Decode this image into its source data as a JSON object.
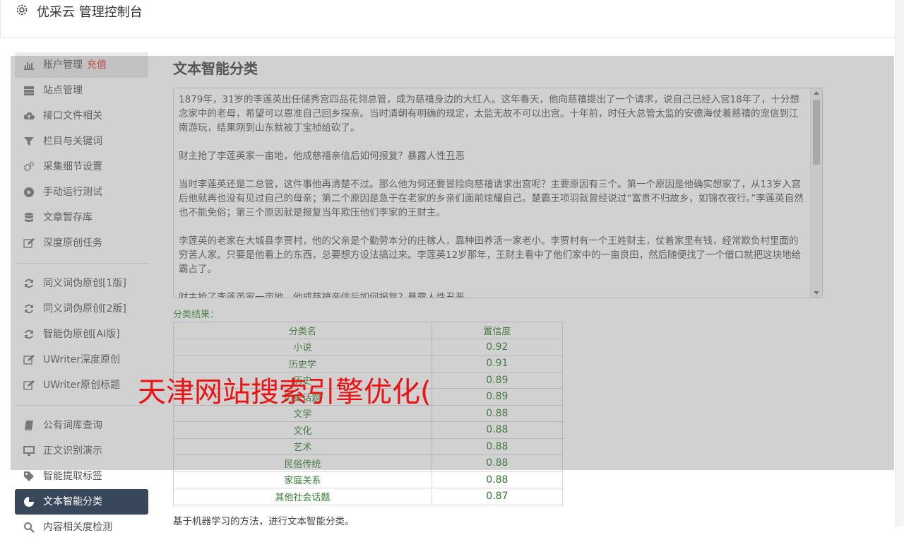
{
  "header": {
    "title": "优采云 管理控制台",
    "icon": "gear-icon"
  },
  "sidebar": {
    "groups": [
      [
        {
          "label": "账户管理",
          "badge": "充值",
          "icon": "bar-chart-icon"
        },
        {
          "label": "站点管理",
          "icon": "server-icon"
        },
        {
          "label": "接口文件相关",
          "icon": "cloud-upload-icon"
        },
        {
          "label": "栏目与关键词",
          "icon": "filter-icon"
        },
        {
          "label": "采集细节设置",
          "icon": "gears-icon"
        },
        {
          "label": "手动运行测试",
          "icon": "play-circle-icon"
        },
        {
          "label": "文章暂存库",
          "icon": "database-icon"
        },
        {
          "label": "深度原创任务",
          "icon": "edit-icon"
        }
      ],
      [
        {
          "label": "同义词伪原创[1版]",
          "icon": "refresh-icon"
        },
        {
          "label": "同义词伪原创[2版]",
          "icon": "refresh-icon"
        },
        {
          "label": "智能伪原创[AI版]",
          "icon": "refresh-icon"
        },
        {
          "label": "UWriter深度原创",
          "icon": "edit-icon"
        },
        {
          "label": "UWriter原创标题",
          "icon": "edit-icon"
        }
      ],
      [
        {
          "label": "公有词库查询",
          "icon": "book-icon"
        },
        {
          "label": "正文识别演示",
          "icon": "desktop-icon"
        },
        {
          "label": "智能提取标签",
          "icon": "tag-icon"
        },
        {
          "label": "文本智能分类",
          "icon": "pie-chart-icon",
          "active": true
        },
        {
          "label": "内容相关度检测",
          "icon": "search-icon"
        }
      ]
    ]
  },
  "main": {
    "title": "文本智能分类",
    "text_paragraphs": [
      "1879年，31岁的李莲英出任储秀宫四品花翎总管，成为慈禧身边的大红人。这年春天，他向慈禧提出了一个请求，说自己已经入宫18年了，十分想念家中的老母，希望可以恩准自己回乡探亲。当时清朝有明确的规定，太监无故不可以出宫。十年前，时任大总管太监的安德海仗着慈禧的宠信到江南游玩，结果刚到山东就被丁宝桢给砍了。",
      "财主抢了李莲英家一亩地，他成慈禧亲信后如何报复？暴露人性丑恶",
      "当时李莲英还是二总管，这件事他再清楚不过。那么他为何还要冒险向慈禧请求出宫呢？主要原因有三个。第一个原因是他确实想家了，从13岁入宫后他就再也没有见过自己的母亲；第二个原因是急于在老家的乡亲们面前炫耀自己。楚霸王项羽就曾经说过“富贵不归故乡，如锦衣夜行。”李莲英自然也不能免俗；第三个原因就是报复当年欺压他们李家的王财主。",
      "李莲英的老家在大城县李贾村，他的父亲是个勤劳本分的庄稼人，靠种田养活一家老小。李贾村有一个王姓财主，仗着家里有钱，经常欺负村里面的穷苦人家。只要是他看上的东西，总要想方设法搞过来。李莲英12岁那年，王财主看中了他们家中的一亩良田，然后随便找了一个借口就把这块地给霸占了。",
      "财主抢了李莲英家一亩地，他成慈禧亲信后如何报复？暴露人性丑恶"
    ],
    "result_label": "分类结果：",
    "table": {
      "headers": [
        "分类名",
        "置信度"
      ],
      "rows": [
        [
          "小说",
          "0.92"
        ],
        [
          "历史学",
          "0.91"
        ],
        [
          "历史",
          "0.89"
        ],
        [
          "历史话题",
          "0.89"
        ],
        [
          "文学",
          "0.88"
        ],
        [
          "文化",
          "0.88"
        ],
        [
          "艺术",
          "0.88"
        ],
        [
          "民俗传统",
          "0.88"
        ],
        [
          "家庭关系",
          "0.88"
        ],
        [
          "其他社会话题",
          "0.87"
        ]
      ]
    },
    "description": "基于机器学习的方法，进行文本智能分类。"
  },
  "watermark": "天津网站搜索引擎优化(",
  "colors": {
    "active_nav": "#39475a",
    "result_green": "#2e7d2e",
    "badge_red": "#e3342f",
    "watermark_red": "#ee1111"
  }
}
